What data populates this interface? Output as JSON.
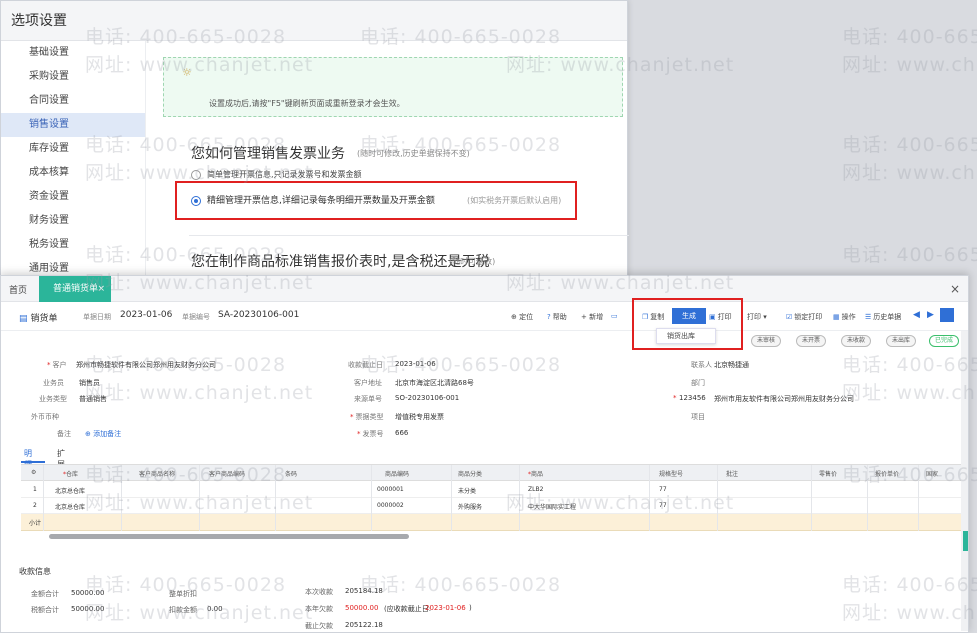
{
  "watermark": {
    "phone": "电话: 400-665-0028",
    "site": "网址: www.chanjet.net"
  },
  "options_window": {
    "title": "选项设置",
    "sidebar": [
      {
        "label": "基础设置",
        "active": false
      },
      {
        "label": "采购设置",
        "active": false
      },
      {
        "label": "合同设置",
        "active": false
      },
      {
        "label": "销售设置",
        "active": true
      },
      {
        "label": "库存设置",
        "active": false
      },
      {
        "label": "成本核算",
        "active": false
      },
      {
        "label": "资金设置",
        "active": false
      },
      {
        "label": "财务设置",
        "active": false
      },
      {
        "label": "税务设置",
        "active": false
      },
      {
        "label": "通用设置",
        "active": false
      }
    ],
    "notice": "设置成功后,请按\"F5\"键刷新页面或重新登录才会生效。",
    "q1": {
      "title": "您如何管理销售发票业务",
      "note": "(随时可修改,历史单据保持不变)",
      "option1": "简单管理开票信息,只记录发票号和发票金额",
      "option2": "精细管理开票信息,详细记录每条明细开票数量及开票金额",
      "option2_note": "(如实税务开票后默认启用)"
    },
    "q2": {
      "title": "您在制作商品标准销售报价表时,是含税还是无税",
      "note": "(随时可修改)"
    }
  },
  "order_window": {
    "tabs": {
      "home": "首页",
      "active": "普通销货单",
      "close": "×"
    },
    "win_close": "×",
    "toolbar": {
      "doc_type": "销货单",
      "doc_date_label": "单据日期",
      "doc_date": "2023-01-06",
      "doc_no_label": "单据编号",
      "doc_no": "SA-20230106-001",
      "buttons": {
        "locate": "⊕ 定位",
        "help": "帮助",
        "new": "+ 新增",
        "copy": "复制",
        "generate": "生成",
        "print": "打印",
        "file_print": "打印",
        "lock_print": "锁定打印",
        "batch": "操作",
        "history": "历史单据"
      },
      "generate_menu": "销货出库"
    },
    "status": [
      "未审核",
      "未开票",
      "未收款",
      "未出库",
      "已完成"
    ],
    "fields": {
      "customer_label": "客户",
      "customer": "郑州市畅捷软件有限公司郑州用友财务分公司",
      "salesperson_label": "业务员",
      "salesperson": "销售员",
      "currency_label": "外币币种",
      "currency": "",
      "sale_type_label": "业务类型",
      "sale_type": "普通销售",
      "remark_label": "备注",
      "remark_link": "添加备注",
      "receipt_date_label": "收款截止日",
      "receipt_date": "2023-01-06",
      "address_label": "客户地址",
      "address": "北京市海淀区北清路68号",
      "source_label": "来源单号",
      "source": "SO-20230106-001",
      "type_label": "票据类型",
      "type": "增值税专用发票",
      "invoice_label": "发票号",
      "invoice": "666",
      "contact_label": "联系人",
      "contact": "北京畅捷通",
      "dept_label": "部门",
      "dept": "",
      "phone_label": "电话",
      "phone": "123456",
      "phone_desc": "郑州市用友软件有限公司郑州用友财务分公司",
      "project_label": "项目",
      "project": ""
    },
    "detail_tabs": [
      "明细",
      "扩展"
    ],
    "grid": {
      "headers": [
        "",
        "仓库",
        "客户商品名称",
        "客户商品编码",
        "条码",
        "商品编码",
        "商品分类",
        "商品",
        "规格型号",
        "批注",
        "零售价",
        "报价单价",
        "国家"
      ],
      "rows": [
        {
          "no": "1",
          "warehouse": "北京总仓库",
          "code": "0000001",
          "category": "未分类",
          "item": "ZLB2",
          "spec": "77"
        },
        {
          "no": "2",
          "warehouse": "北京总仓库",
          "code": "0000002",
          "category": "外购服务",
          "item": "中大华国际实工程",
          "spec": "77"
        }
      ],
      "total_label": "小计"
    },
    "summary": {
      "title": "收款信息",
      "total_amount_label": "金额合计",
      "total_amount": "50000.00",
      "tax_amount_label": "税额合计",
      "tax_amount": "50000.00",
      "discount_label": "整单折扣",
      "discount": "",
      "deduct_label": "扣款金额",
      "deduct": "0.00",
      "this_receive_label": "本次收款",
      "this_receive": "205184.18",
      "balance_label": "本年欠款",
      "balance": "50000.00",
      "balance_note": "(应收款截止日:",
      "balance_date": "2023-01-06",
      "balance_end": ")",
      "last_label": "截止欠款",
      "last": "205122.18"
    }
  }
}
